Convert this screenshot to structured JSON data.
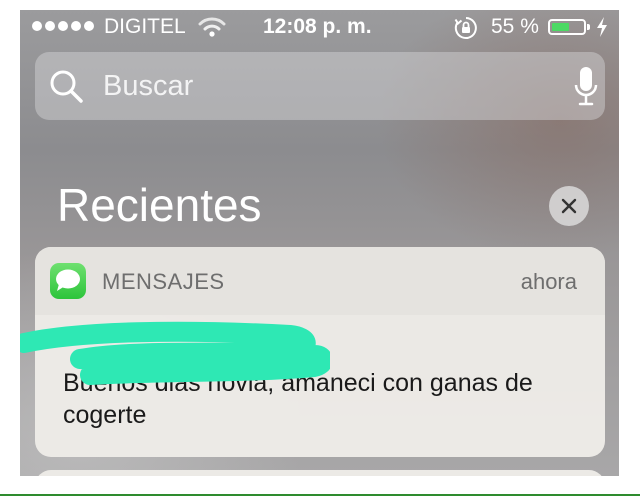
{
  "status_bar": {
    "carrier": "DIGITEL",
    "time": "12:08 p. m.",
    "battery_percent": "55 %",
    "battery_level": 0.55,
    "icons": [
      "signal-dots-icon",
      "wifi-icon",
      "rotation-lock-icon",
      "battery-icon",
      "charging-bolt-icon"
    ]
  },
  "search": {
    "placeholder": "Buscar",
    "value": "",
    "icons": [
      "search-icon",
      "microphone-icon"
    ]
  },
  "recents": {
    "title": "Recientes",
    "clear_icon": "close-icon"
  },
  "notification": {
    "app_name": "MENSAJES",
    "app_icon": "messages-app-icon",
    "timestamp": "ahora",
    "body": "Buenos dias novia, amaneci con ganas de cogerte",
    "sender_redacted": true
  },
  "colors": {
    "battery_green": "#4cd964",
    "messages_green": "#2cc43a",
    "redaction_teal": "#2ee8b4"
  }
}
